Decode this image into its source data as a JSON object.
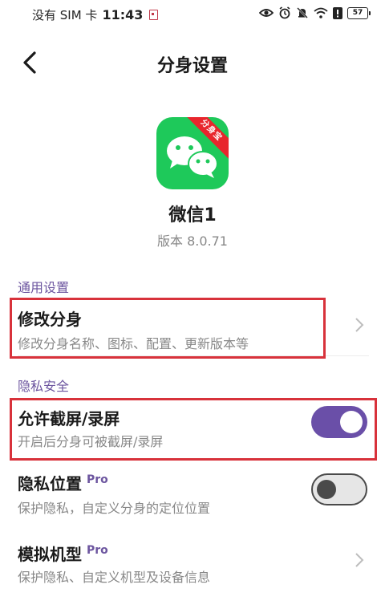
{
  "status_bar": {
    "carrier": "没有 SIM 卡",
    "time": "11:43",
    "battery": "57"
  },
  "header": {
    "title": "分身设置"
  },
  "app": {
    "name": "微信1",
    "version": "版本 8.0.71",
    "badge": "分身宝",
    "brand_color": "#1ec95a"
  },
  "sections": {
    "general": {
      "title": "通用设置"
    },
    "privacy": {
      "title": "隐私安全"
    }
  },
  "rows": {
    "modify_clone": {
      "title": "修改分身",
      "subtitle": "修改分身名称、图标、配置、更新版本等"
    },
    "allow_screenshot": {
      "title": "允许截屏/录屏",
      "subtitle": "开启后分身可被截屏/录屏",
      "enabled": true
    },
    "privacy_location": {
      "title": "隐私位置",
      "badge": "Pro",
      "subtitle": "保护隐私，自定义分身的定位位置",
      "enabled": false
    },
    "simulate_model": {
      "title": "模拟机型",
      "badge": "Pro",
      "subtitle": "保护隐私、自定义机型及设备信息"
    }
  },
  "colors": {
    "accent": "#6a4fa8",
    "section_text": "#6c559f",
    "highlight": "#d8323b"
  }
}
